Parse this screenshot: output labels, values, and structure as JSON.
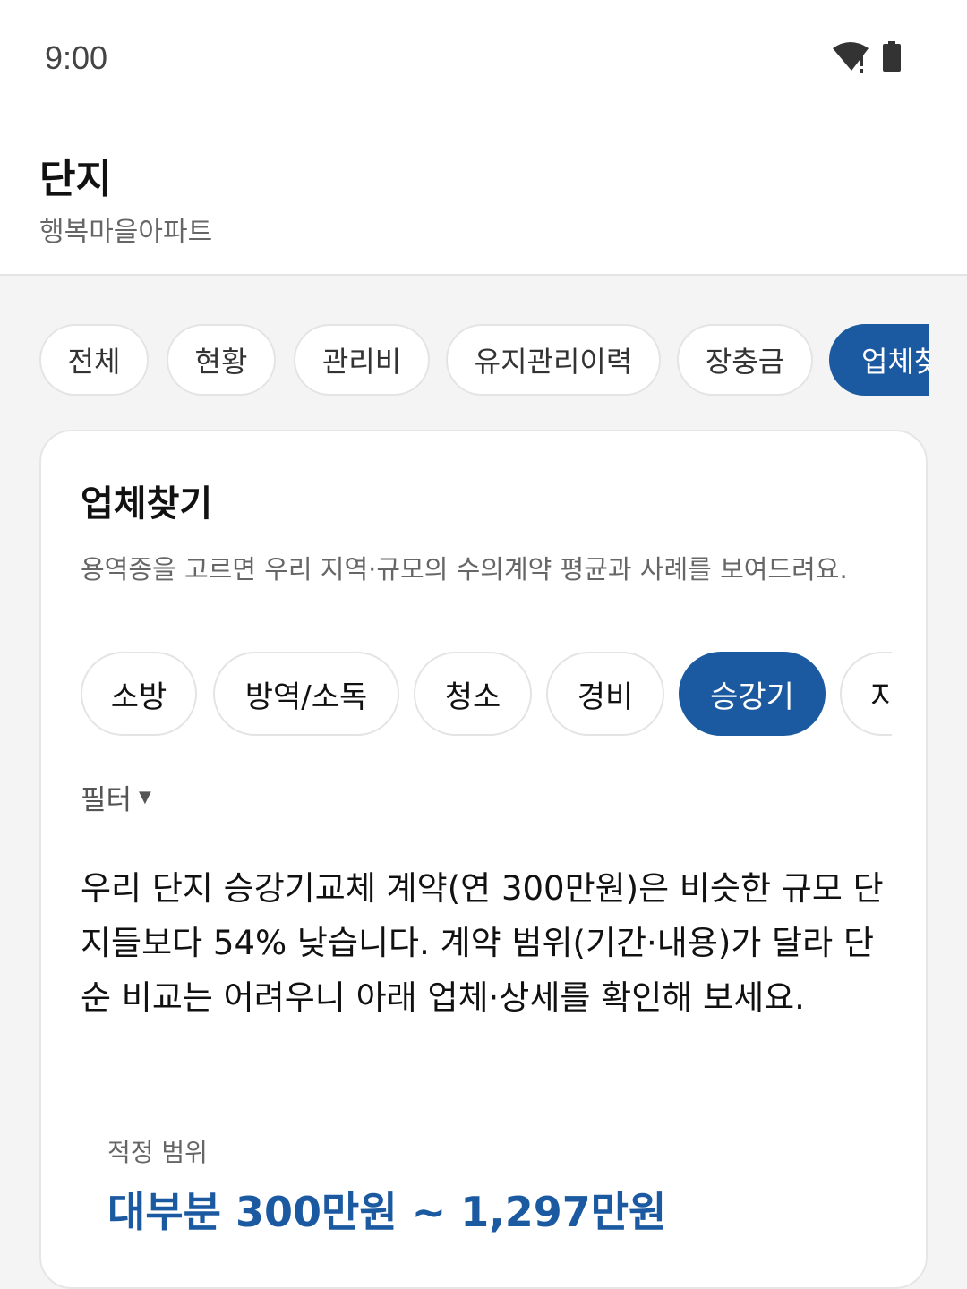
{
  "status_bar": {
    "time": "9:00"
  },
  "header": {
    "title": "단지",
    "subtitle": "행복마을아파트"
  },
  "tabs": [
    {
      "label": "전체",
      "active": false
    },
    {
      "label": "현황",
      "active": false
    },
    {
      "label": "관리비",
      "active": false
    },
    {
      "label": "유지관리이력",
      "active": false
    },
    {
      "label": "장충금",
      "active": false
    },
    {
      "label": "업체찾기",
      "active": true
    }
  ],
  "card": {
    "title": "업체찾기",
    "description": "용역종을 고르면 우리 지역·규모의 수의계약 평균과 사례를 보여드려요.",
    "categories": [
      {
        "label": "소방",
        "active": false
      },
      {
        "label": "방역/소독",
        "active": false
      },
      {
        "label": "청소",
        "active": false
      },
      {
        "label": "경비",
        "active": false
      },
      {
        "label": "승강기",
        "active": true
      },
      {
        "label": "지",
        "active": false
      }
    ],
    "filter_label": "필터",
    "summary": "우리 단지 승강기교체 계약(연 300만원)은 비슷한 규모 단지들보다 54% 낮습니다. 계약 범위(기간·내용)가 달라 단순 비교는 어려우니 아래 업체·상세를 확인해 보세요.",
    "range_label": "적정 범위",
    "range_value": "대부분 300만원 ~ 1,297만원"
  },
  "colors": {
    "accent": "#1b5aa0",
    "background": "#f3f4f3",
    "card": "#ffffff"
  },
  "icons": [
    "wifi-icon",
    "battery-icon",
    "caret-down-icon"
  ]
}
